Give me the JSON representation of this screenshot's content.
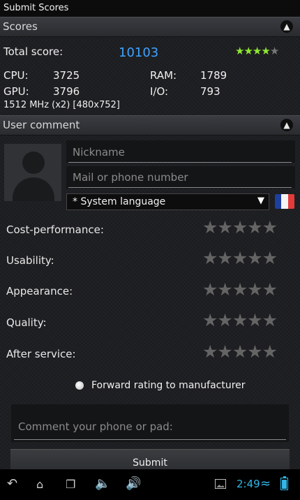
{
  "window": {
    "title": "Submit Scores"
  },
  "scores_section": {
    "title": "Scores",
    "collapse_icon": "chevron-up-icon"
  },
  "scores": {
    "total_label": "Total score:",
    "total_value": "10103",
    "rating_stars": {
      "filled": 4,
      "total": 5,
      "colors": {
        "filled": "#8fe830",
        "empty": "#777777"
      }
    },
    "cpu_label": "CPU:",
    "cpu_value": "3725",
    "ram_label": "RAM:",
    "ram_value": "1789",
    "gpu_label": "GPU:",
    "gpu_value": "3796",
    "io_label": "I/O:",
    "io_value": "793",
    "device_info": "1512 MHz (x2) [480x752]"
  },
  "comment_section": {
    "title": "User comment",
    "collapse_icon": "chevron-up-icon"
  },
  "form": {
    "nickname_placeholder": "Nickname",
    "contact_placeholder": "Mail or phone number",
    "language_value": "* System language",
    "flag": "france-flag",
    "ratings": [
      {
        "label": "Cost-performance:",
        "stars": 0
      },
      {
        "label": "Usability:",
        "stars": 0
      },
      {
        "label": "Appearance:",
        "stars": 0
      },
      {
        "label": "Quality:",
        "stars": 0
      },
      {
        "label": "After service:",
        "stars": 0
      }
    ],
    "forward_label": "Forward rating to manufacturer",
    "comment_placeholder": "Comment your phone or pad:",
    "submit_label": "Submit"
  },
  "navbar": {
    "clock": "2:49"
  },
  "colors": {
    "accent": "#3ea3ff",
    "system_blue": "#33b5e5"
  }
}
